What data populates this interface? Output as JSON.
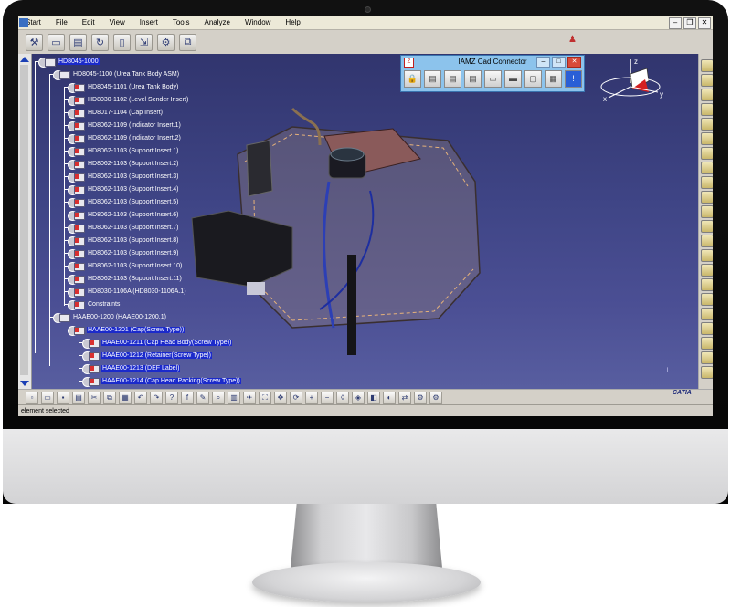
{
  "menu": [
    "Start",
    "File",
    "Edit",
    "View",
    "Insert",
    "Tools",
    "Analyze",
    "Window",
    "Help"
  ],
  "tree": {
    "root": "HD8045-1000",
    "items": [
      {
        "label": "HD8045-1100 (Urea Tank Body ASM)",
        "level": 1
      },
      {
        "label": "HD8045-1101 (Urea Tank Body)",
        "level": 2
      },
      {
        "label": "HD8030-1102 (Level Sender Insert)",
        "level": 2
      },
      {
        "label": "HD8017-1104  (Cap Insert)",
        "level": 2
      },
      {
        "label": "HD8062-1109 (Indicator Insert.1)",
        "level": 2
      },
      {
        "label": "HD8062-1109 (Indicator Insert.2)",
        "level": 2
      },
      {
        "label": "HD8062-1103 (Support Insert.1)",
        "level": 2
      },
      {
        "label": "HD8062-1103 (Support Insert.2)",
        "level": 2
      },
      {
        "label": "HD8062-1103 (Support Insert.3)",
        "level": 2
      },
      {
        "label": "HD8062-1103 (Support Insert.4)",
        "level": 2
      },
      {
        "label": "HD8062-1103 (Support Insert.5)",
        "level": 2
      },
      {
        "label": "HD8062-1103 (Support Insert.6)",
        "level": 2
      },
      {
        "label": "HD8062-1103 (Support Insert.7)",
        "level": 2
      },
      {
        "label": "HD8062-1103 (Support Insert.8)",
        "level": 2
      },
      {
        "label": "HD8062-1103 (Support Insert.9)",
        "level": 2
      },
      {
        "label": "HD8062-1103 (Support Insert.10)",
        "level": 2
      },
      {
        "label": "HD8062-1103 (Support Insert.11)",
        "level": 2
      },
      {
        "label": "HD8030-1106A (HD8030-1106A.1)",
        "level": 2
      },
      {
        "label": "Constraints",
        "level": 2
      },
      {
        "label": "HAAE00-1200 (HAAE00-1200.1)",
        "level": 1
      },
      {
        "label": "HAAE00-1201 (Cap(Screw Type))",
        "level": 2,
        "selected": true
      },
      {
        "label": "HAAE00-1211 (Cap Head Body(Screw Type))",
        "level": 3,
        "selected": true
      },
      {
        "label": "HAAE00-1212 (Retainer(Screw Type))",
        "level": 3,
        "selected": true
      },
      {
        "label": "HAAE00-1213 (DEF Label)",
        "level": 3,
        "selected": true
      },
      {
        "label": "HAAE00-1214 (Cap Head Packing(Screw Type))",
        "level": 3,
        "selected": true
      }
    ]
  },
  "connector": {
    "title": "IAMZ Cad Connector",
    "tools": [
      "lock-icon",
      "doc-icon",
      "doc-icon",
      "doc-icon",
      "folder-icon",
      "folder-icon",
      "doc-icon",
      "grid-icon",
      "info-icon"
    ]
  },
  "status": {
    "text": "element selected"
  },
  "catia_logo": "CATIA",
  "axis": {
    "x": "x",
    "y": "y",
    "z": "z"
  },
  "colors": {
    "viewport_top": "#31356e",
    "viewport_bottom": "#585ea0",
    "selection": "#1b2acb",
    "connector_bg": "#8cc3ec"
  }
}
